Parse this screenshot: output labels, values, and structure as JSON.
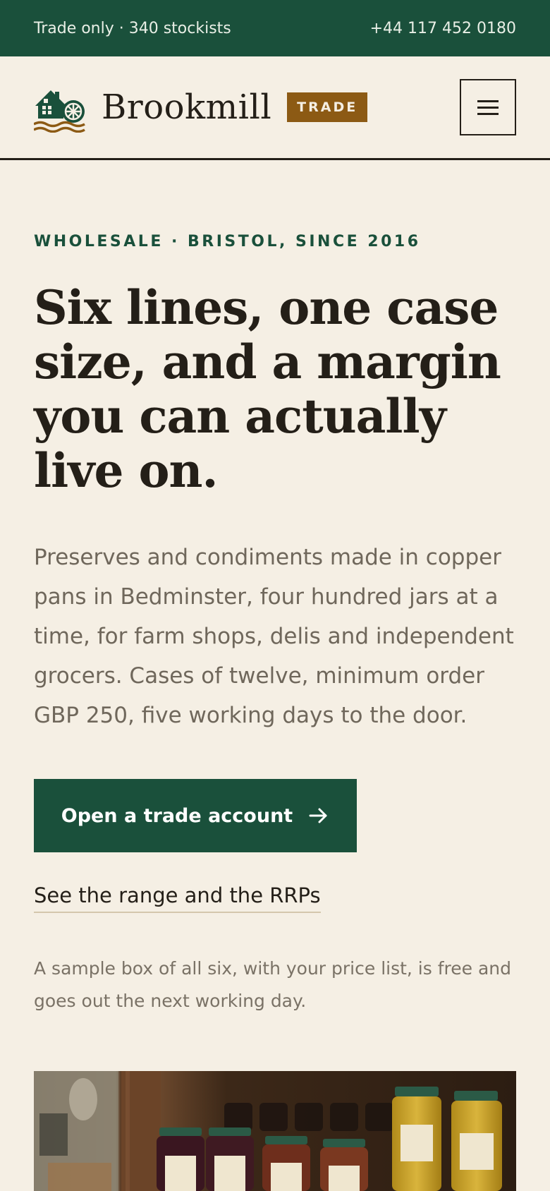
{
  "topbar": {
    "tagline": "Trade only · 340 stockists",
    "phone": "+44 117 452 0180"
  },
  "header": {
    "brand": "Brookmill",
    "badge": "TRADE",
    "logo_icon": "house-waterwheel-icon",
    "menu_icon": "hamburger-menu-icon",
    "menu_label": "Menu"
  },
  "hero": {
    "eyebrow": "WHOLESALE · BRISTOL, SINCE 2016",
    "headline": "Six lines, one case size, and a margin you can actually live on.",
    "lead": "Preserves and condiments made in copper pans in Bedminster, four hundred jars at a time, for farm shops, delis and independent grocers. Cases of twelve, minimum order GBP 250, five working days to the door.",
    "cta_label": "Open a trade account",
    "cta_icon": "arrow-right-icon",
    "secondary_link": "See the range and the RRPs",
    "note": "A sample box of all six, with your price list, is free and goes out the next working day.",
    "image_alt": "Shelves of Brookmill preserve jars"
  },
  "colors": {
    "brand_green": "#1a503b",
    "accent_brown": "#8c5a14",
    "background": "#f5efe4",
    "ink": "#241f18"
  }
}
